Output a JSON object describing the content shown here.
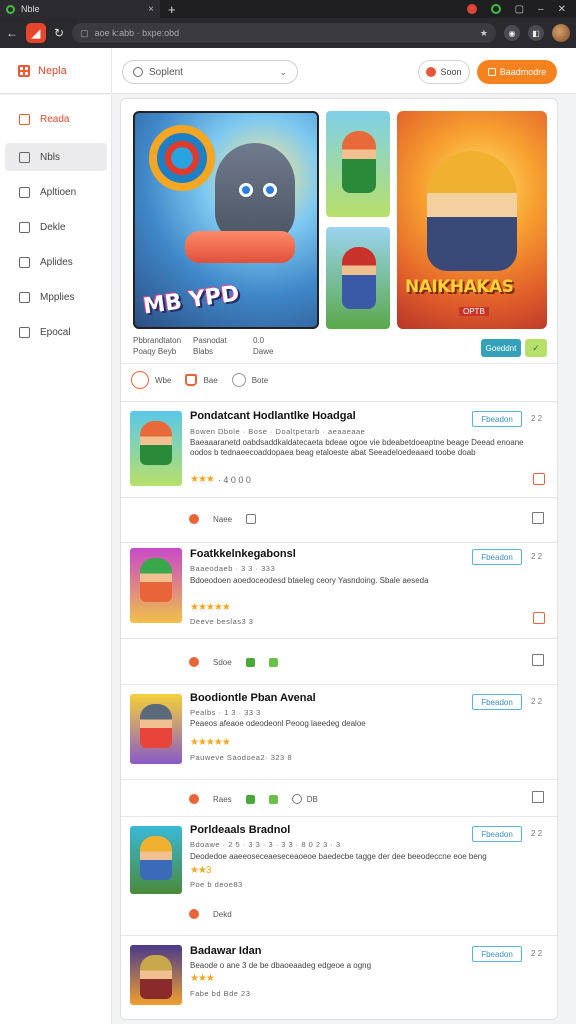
{
  "browser": {
    "tab_title": "Nble",
    "url": "aoe k:abb · bxpe:obd",
    "new_tab": "+",
    "close": "×",
    "back": "←",
    "refresh": "↻",
    "bookmark": "★"
  },
  "header": {
    "brand": "Nepla",
    "search_placeholder": "Soplent",
    "btn_secondary": "Soon",
    "btn_primary": "Baadmodre"
  },
  "sidebar": {
    "items": [
      {
        "label": "Reada"
      },
      {
        "label": "Nbls"
      },
      {
        "label": "Apltioen"
      },
      {
        "label": "Dekle"
      },
      {
        "label": "Aplides"
      },
      {
        "label": "Mpplies"
      },
      {
        "label": "Epocal"
      }
    ]
  },
  "featured": {
    "big_logo": "MB YPD",
    "right_title": "NAIKHAKAS",
    "right_sub": "OPTB",
    "meta": [
      {
        "l1": "Pbbrandtaton",
        "l2": "Poaqy Beyb"
      },
      {
        "l1": "Pasnodat",
        "l2": "Blabs"
      },
      {
        "l1": "0.0",
        "l2": "Dawe"
      }
    ],
    "tag_green": "Goeddnt",
    "tag_lime": "✓"
  },
  "tabs": [
    {
      "label": "Wbe"
    },
    {
      "label": "Bae"
    },
    {
      "label": "Bote"
    }
  ],
  "items": [
    {
      "title": "Pondatcant Hodlantlke Hoadgal",
      "sub": "Bowen Dbole · Bose · Doaltpetarb · aeaaeaae",
      "desc": "Baeaaaranetd oabdsaddkaldatecaeta bdeae ogoe vie bdeabetdoeaptne beage Deead enoane oodos b tednaeecoaddopaea beag etaloeste abat Seeadeloedeaaed toobe doab",
      "stars": "★★★",
      "rating": "· 4 0 0 0",
      "btn": "Fbeadon",
      "more": "2 2",
      "act1": "Naee"
    },
    {
      "title": "Foatkkelnkegabonsl",
      "sub": "Baaeodaeb · 3 3 · 333",
      "desc": "Bdoeodoen aoedoceodesd btaeleg ceory Yasndoing. Sbale aeseda",
      "stars": "★★★★★",
      "rating": "Deeve beslas3 3",
      "btn": "Fbeadon",
      "more": "2 2",
      "act1": "Sdoe"
    },
    {
      "title": "Boodiontle Pban Avenal",
      "sub": "Pealbs · 1 3 · 33 3",
      "desc": "Peaeos afeaoe odeodeonl Peoog laeedeg dealoe",
      "stars": "★★★★★",
      "rating": "Pauweve Saodoea2· 323 8",
      "btn": "Fbeadon",
      "more": "2 2",
      "act1": "Raes",
      "act4": "DB"
    },
    {
      "title": "Porldeaals Bradnol",
      "sub": "Bdoawe · 2 5 · 3 3 · 3 · 3 3 · 8 0 2 3 · 3",
      "desc": "Deodedoe aaeeoseceaeseceaoeoe baedecbe tagge der dee beeodeccne eoe beng",
      "stars": "★★3",
      "rating": "Poe b deoe83",
      "btn": "Fbeadon",
      "more": "2 2",
      "act1": "Dekd"
    },
    {
      "title": "Badawar Idan",
      "sub": "",
      "desc": "Beaode o ane 3 de be dbaoeaadeg edgeoe a ogng",
      "stars": "★★★",
      "rating": "Fabe bd Bde 23",
      "btn": "Fbeadon",
      "more": "2 2"
    }
  ],
  "colors": {
    "accent_orange": "#f5821f",
    "brand_red": "#e04a2a",
    "star": "#f5a623",
    "teal": "#34a1b8"
  }
}
